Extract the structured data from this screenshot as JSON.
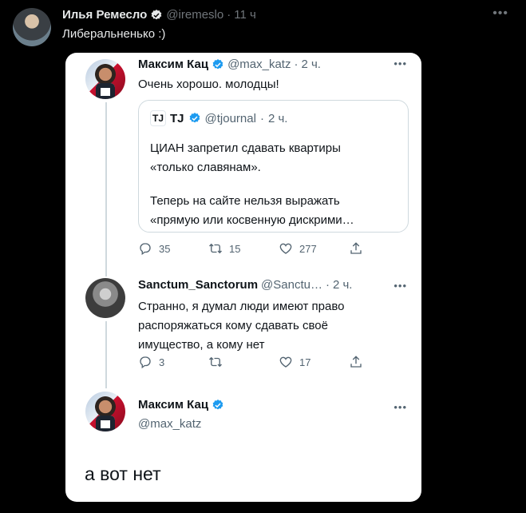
{
  "outer": {
    "name": "Илья Ремесло",
    "handle": "@iremeslo",
    "dot": "·",
    "time": "11 ч",
    "more": "•••",
    "text": "Либеральненько :)"
  },
  "tweet1": {
    "name": "Максим Кац",
    "handle": "@max_katz",
    "dot": "·",
    "time": "2 ч.",
    "more": "•••",
    "text": "Очень хорошо. молодцы!",
    "quote": {
      "logo": "TJ",
      "name": "TJ",
      "handle": "@tjournal",
      "dot": "·",
      "time": "2 ч.",
      "line1": "ЦИАН запретил сдавать квартиры",
      "line2": "«только славянам».",
      "line3": "Теперь на сайте нельзя выражать",
      "line4": "«прямую или косвенную дискрими…"
    },
    "replies": "35",
    "retweets": "15",
    "likes": "277"
  },
  "tweet2": {
    "name": "Sanctum_Sanctorum",
    "handle": "@Sanctu…",
    "dot": "·",
    "time": "2 ч.",
    "more": "•••",
    "line1": "Странно, я думал люди имеют право",
    "line2": "распоряжаться кому сдавать своё",
    "line3": "имущество, а кому нет",
    "replies": "3",
    "retweets": "",
    "likes": "17"
  },
  "tweet3": {
    "name": "Максим Кац",
    "handle": "@max_katz",
    "more": "•••",
    "text": "а вот нет"
  },
  "colors": {
    "verified": "#1d9bf0",
    "background": "#000000",
    "card": "#ffffff"
  }
}
